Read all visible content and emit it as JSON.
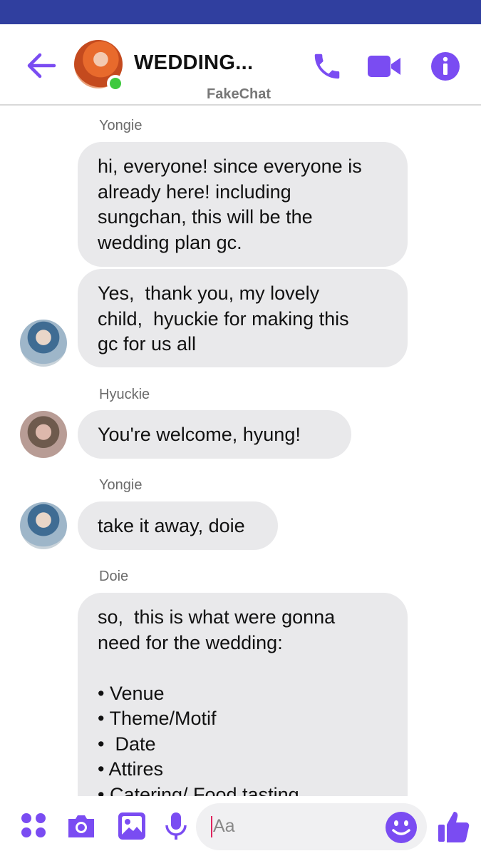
{
  "header": {
    "title": "WEDDING...",
    "subtitle": "FakeChat",
    "accent_color": "#7a4cf2",
    "status_bar_color": "#303f9f"
  },
  "messages": [
    {
      "sender": "Yongie",
      "text": "hi, everyone! since everyone is\nalready here! including\nsungchan, this will be the\nwedding plan gc."
    },
    {
      "sender": "",
      "text": "Yes,  thank you, my lovely\nchild,  hyuckie for making this\ngc for us all"
    },
    {
      "sender": "Hyuckie",
      "text": "You're welcome, hyung!"
    },
    {
      "sender": "Yongie",
      "text": "take it away, doie"
    },
    {
      "sender": "Doie",
      "text": "so,  this is what were gonna\nneed for the wedding:\n\n• Venue\n• Theme/Motif\n•  Date\n• Attires\n• Catering/ Food tasting"
    }
  ],
  "composer": {
    "placeholder": "Aa",
    "icons": [
      "menu-dots-icon",
      "camera-icon",
      "gallery-icon",
      "microphone-icon",
      "emoji-icon",
      "thumbs-up-icon"
    ]
  }
}
